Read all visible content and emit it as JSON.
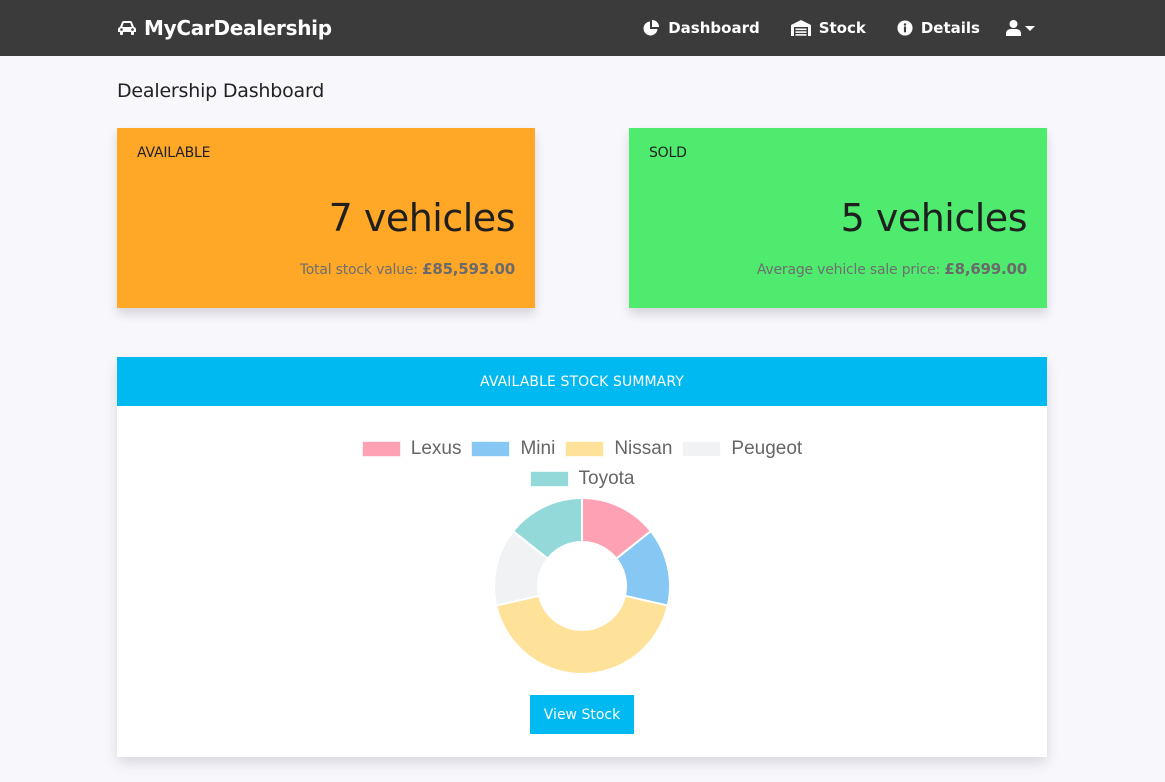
{
  "navbar": {
    "brand": "MyCarDealership",
    "links": [
      {
        "label": "Dashboard",
        "icon": "chart-pie-icon"
      },
      {
        "label": "Stock",
        "icon": "warehouse-icon"
      },
      {
        "label": "Details",
        "icon": "info-circle-icon"
      }
    ],
    "user_icon": "user-icon",
    "bg_color": "#3b3b3b"
  },
  "page": {
    "title": "Dealership Dashboard"
  },
  "stats": {
    "available": {
      "label": "AVAILABLE",
      "count": "7 vehicles",
      "sub_label": "Total stock value:",
      "sub_value": "£85,593.00",
      "color": "#ffa726"
    },
    "sold": {
      "label": "SOLD",
      "count": "5 vehicles",
      "sub_label": "Average vehicle sale price:",
      "sub_value": "£8,699.00",
      "color": "#4feb6e"
    }
  },
  "summary": {
    "header": "AVAILABLE STOCK SUMMARY",
    "header_color": "#00b9f1",
    "button_label": "View Stock"
  },
  "chart_data": {
    "type": "pie",
    "variant": "doughnut",
    "categories": [
      "Lexus",
      "Mini",
      "Nissan",
      "Peugeot",
      "Toyota"
    ],
    "values": [
      1,
      1,
      3,
      1,
      1
    ],
    "colors": [
      "#ffa1b5",
      "#86c7f3",
      "#ffe29a",
      "#f1f2f4",
      "#93d9d9"
    ],
    "legend_position": "top",
    "title": ""
  }
}
